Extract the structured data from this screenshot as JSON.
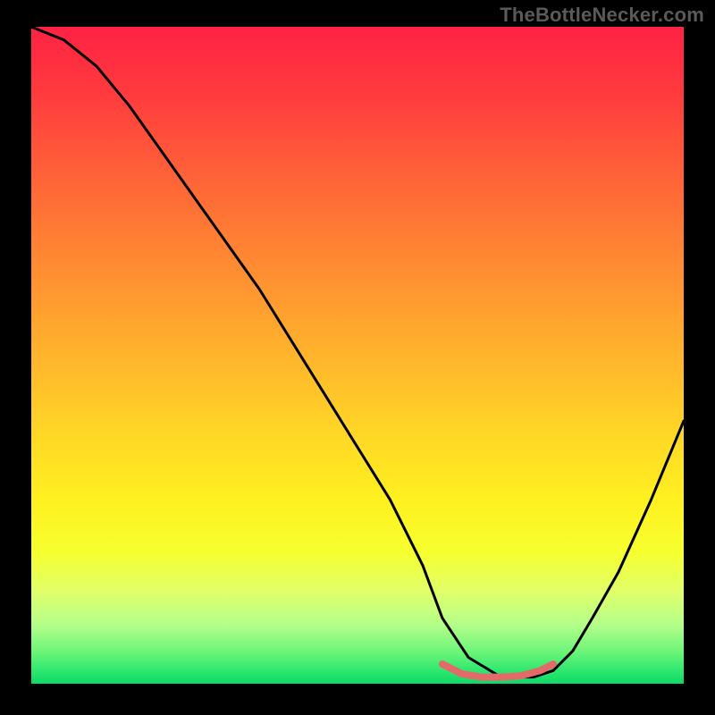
{
  "watermark": "TheBottleNecker.com",
  "chart_data": {
    "type": "line",
    "title": "",
    "xlabel": "",
    "ylabel": "",
    "xlim": [
      0,
      100
    ],
    "ylim": [
      0,
      100
    ],
    "series": [
      {
        "name": "curve",
        "x": [
          0,
          5,
          10,
          15,
          20,
          25,
          30,
          35,
          40,
          45,
          50,
          55,
          60,
          63,
          67,
          72,
          77,
          80,
          83,
          86,
          90,
          95,
          100
        ],
        "values": [
          100,
          98,
          94,
          88,
          81,
          74,
          67,
          60,
          52,
          44,
          36,
          28,
          18,
          10,
          4,
          1,
          1,
          2,
          5,
          10,
          17,
          28,
          40
        ]
      },
      {
        "name": "minimum-segment",
        "x": [
          63,
          66,
          69,
          72,
          75,
          78,
          80
        ],
        "values": [
          3.0,
          1.5,
          1.0,
          1.0,
          1.2,
          2.0,
          3.0
        ]
      }
    ],
    "gradient_stops": [
      {
        "pct": 0,
        "color": "#ff2244"
      },
      {
        "pct": 10,
        "color": "#ff3a3e"
      },
      {
        "pct": 22,
        "color": "#ff6038"
      },
      {
        "pct": 36,
        "color": "#ff8a32"
      },
      {
        "pct": 50,
        "color": "#ffb42c"
      },
      {
        "pct": 62,
        "color": "#ffd726"
      },
      {
        "pct": 72,
        "color": "#fff020"
      },
      {
        "pct": 80,
        "color": "#f6ff2e"
      },
      {
        "pct": 86,
        "color": "#e0ff6a"
      },
      {
        "pct": 91,
        "color": "#b4ff8a"
      },
      {
        "pct": 95,
        "color": "#70f57a"
      },
      {
        "pct": 98,
        "color": "#2ee86e"
      },
      {
        "pct": 100,
        "color": "#0dd868"
      }
    ],
    "colors": {
      "background": "#000000",
      "curve": "#000000",
      "minimum_segment": "#e46a6a",
      "watermark": "#5a5a5a"
    }
  }
}
